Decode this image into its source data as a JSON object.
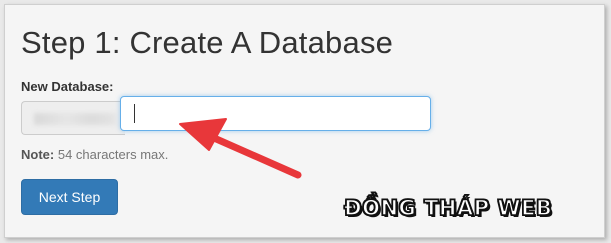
{
  "step": {
    "title": "Step 1: Create A Database"
  },
  "form": {
    "label": "New Database:",
    "input_value": "",
    "note_label": "Note:",
    "note_text": "54 characters max."
  },
  "actions": {
    "next_label": "Next Step"
  },
  "annotation": {
    "arrow_color": "#e8373a",
    "watermark_text": "ĐỒNG THÁP WEB"
  },
  "colors": {
    "primary_button": "#337ab7",
    "focus_border": "#66afe9"
  }
}
